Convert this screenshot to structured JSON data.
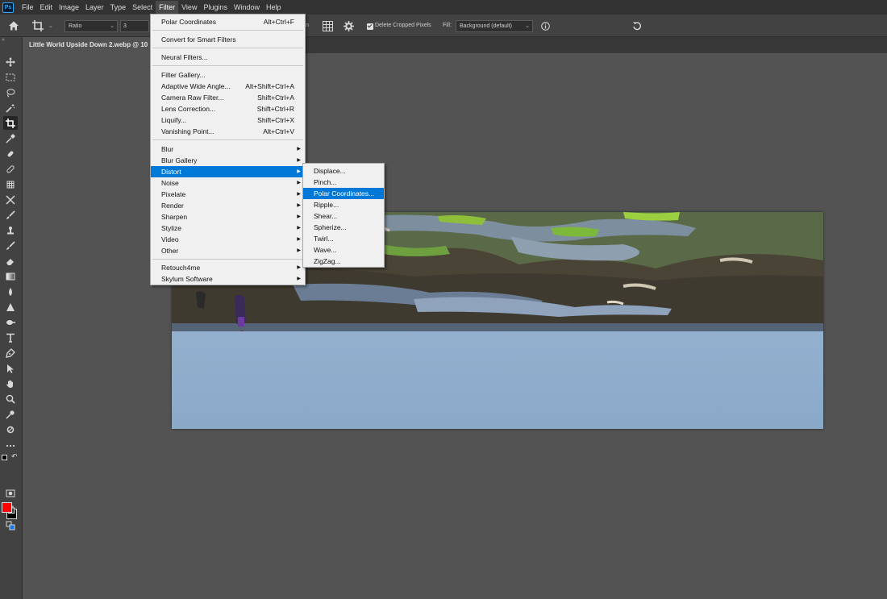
{
  "app": {
    "logo": "Ps"
  },
  "menubar": {
    "items": [
      "File",
      "Edit",
      "Image",
      "Layer",
      "Type",
      "Select",
      "Filter",
      "View",
      "Plugins",
      "Window",
      "Help"
    ],
    "active": "Filter"
  },
  "options": {
    "ratio_label": "Ratio",
    "ratio_value": "3",
    "delete_cropped_label": "Delete Cropped Pixels",
    "delete_cropped_checked": true,
    "fill_label": "Fill:",
    "fill_value": "Background (default)",
    "partial_label": "n"
  },
  "document": {
    "tab_title": "Little World Upside Down 2.webp @ 10"
  },
  "filter_menu": {
    "items": [
      {
        "label": "Polar Coordinates",
        "shortcut": "Alt+Ctrl+F"
      },
      {
        "label": "Convert for Smart Filters",
        "shortcut": ""
      },
      {
        "label": "Neural Filters...",
        "shortcut": ""
      },
      {
        "label": "Filter Gallery...",
        "shortcut": ""
      },
      {
        "label": "Adaptive Wide Angle...",
        "shortcut": "Alt+Shift+Ctrl+A"
      },
      {
        "label": "Camera Raw Filter...",
        "shortcut": "Shift+Ctrl+A"
      },
      {
        "label": "Lens Correction...",
        "shortcut": "Shift+Ctrl+R"
      },
      {
        "label": "Liquify...",
        "shortcut": "Shift+Ctrl+X"
      },
      {
        "label": "Vanishing Point...",
        "shortcut": "Alt+Ctrl+V"
      },
      {
        "label": "Blur",
        "shortcut": ""
      },
      {
        "label": "Blur Gallery",
        "shortcut": ""
      },
      {
        "label": "Distort",
        "shortcut": ""
      },
      {
        "label": "Noise",
        "shortcut": ""
      },
      {
        "label": "Pixelate",
        "shortcut": ""
      },
      {
        "label": "Render",
        "shortcut": ""
      },
      {
        "label": "Sharpen",
        "shortcut": ""
      },
      {
        "label": "Stylize",
        "shortcut": ""
      },
      {
        "label": "Video",
        "shortcut": ""
      },
      {
        "label": "Other",
        "shortcut": ""
      },
      {
        "label": "Retouch4me",
        "shortcut": ""
      },
      {
        "label": "Skylum Software",
        "shortcut": ""
      }
    ],
    "highlighted": "Distort"
  },
  "distort_menu": {
    "items": [
      "Displace...",
      "Pinch...",
      "Polar Coordinates...",
      "Ripple...",
      "Shear...",
      "Spherize...",
      "Twirl...",
      "Wave...",
      "ZigZag..."
    ],
    "highlighted": "Polar Coordinates..."
  },
  "colors": {
    "foreground": "#ff0000",
    "background": "#000000",
    "highlight": "#0078d7"
  },
  "icons": {
    "toolbar": [
      "move-icon",
      "marquee-icon",
      "lasso-icon",
      "magic-wand-icon",
      "crop-icon",
      "eyedropper-icon",
      "healing-icon",
      "brush-icon",
      "stamp-icon",
      "history-brush-icon",
      "eraser-icon",
      "gradient-icon",
      "blur-icon",
      "dodge-icon",
      "pen-icon",
      "type-icon",
      "path-select-icon",
      "shape-icon",
      "hand-icon",
      "zoom-icon",
      "more-icon"
    ]
  }
}
